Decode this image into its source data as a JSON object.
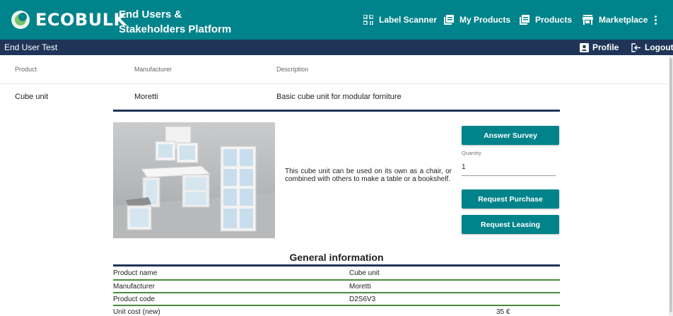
{
  "header": {
    "logo_text": "ECOBULK",
    "platform_title": "End Users & Stakeholders Platform",
    "nav": {
      "label_scanner": "Label Scanner",
      "my_products": "My Products",
      "products": "Products",
      "marketplace": "Marketplace"
    },
    "colors": {
      "primary": "#00838a",
      "navy": "#1f3558",
      "accent_green": "#4a8a3c"
    }
  },
  "subbar": {
    "user_name": "End User Test",
    "profile_label": "Profile",
    "logout_label": "Logout"
  },
  "table": {
    "columns": [
      "Product",
      "Manufacturer",
      "Description"
    ],
    "row": [
      "Cube unit",
      "Moretti",
      "Basic cube unit for modular forniture"
    ]
  },
  "product": {
    "image_alt": "product-photo-cube-unit-shelves",
    "description": "This cube unit can be used on its own as a chair, or combined with others to make a table or a bookshelf."
  },
  "actions": {
    "answer_survey": "Answer Survey",
    "quantity_label": "Quantity",
    "quantity_value": "1",
    "request_purchase": "Request Purchase",
    "request_leasing": "Request Leasing"
  },
  "general_info": {
    "title": "General information",
    "rows": [
      {
        "label": "Product name",
        "value": "Cube unit"
      },
      {
        "label": "Manufacturer",
        "value": "Moretti"
      },
      {
        "label": "Product code",
        "value": "D2S6V3"
      },
      {
        "label": "Unit cost (new)",
        "value": "35 €"
      }
    ]
  }
}
